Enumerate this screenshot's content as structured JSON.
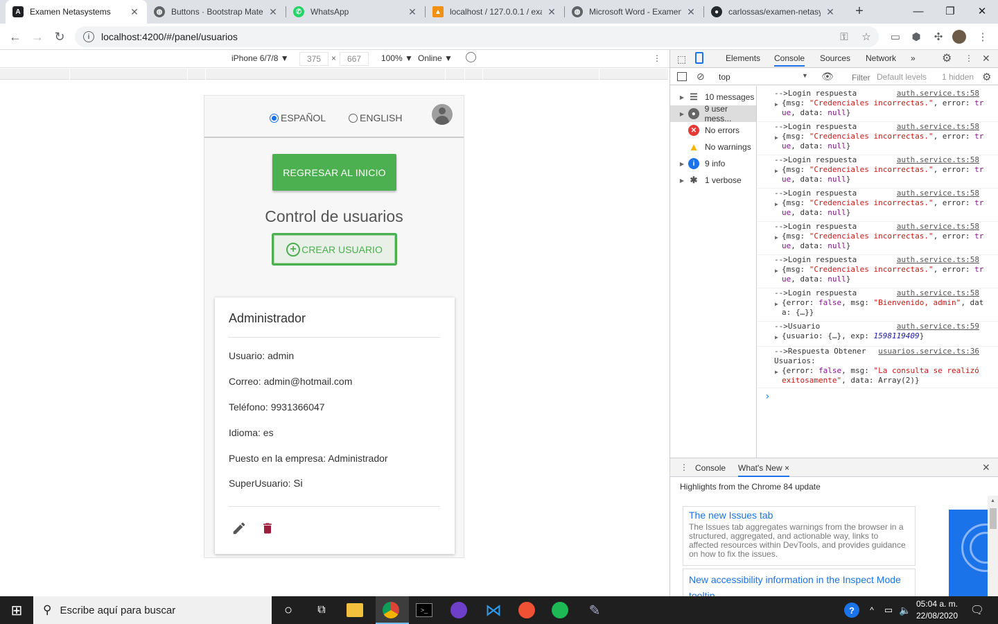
{
  "browser": {
    "tabs": [
      {
        "title": "Examen Netasystems",
        "active": true,
        "icon": "angular-icon"
      },
      {
        "title": "Buttons · Bootstrap Mater",
        "icon": "globe-icon"
      },
      {
        "title": "WhatsApp",
        "icon": "whatsapp-icon"
      },
      {
        "title": "localhost / 127.0.0.1 / exa",
        "icon": "phpmyadmin-icon"
      },
      {
        "title": "Microsoft Word - Examen",
        "icon": "globe-icon"
      },
      {
        "title": "carlossas/examen-netasys",
        "icon": "github-icon"
      }
    ],
    "new_tab": "+",
    "url": "localhost:4200/#/panel/usuarios"
  },
  "device_toolbar": {
    "device": "iPhone 6/7/8 ▼",
    "width": "375",
    "height": "667",
    "x": "×",
    "zoom": "100% ▼",
    "network": "Online ▼"
  },
  "app": {
    "lang_es": "ESPAÑOL",
    "lang_en": "ENGLISH",
    "back_button": "REGRESAR AL INICIO",
    "title": "Control de usuarios",
    "create_button": "CREAR USUARIO",
    "card": {
      "title": "Administrador",
      "fields": [
        "Usuario: admin",
        "Correo: admin@hotmail.com",
        "Teléfono: 9931366047",
        "Idioma: es",
        "Puesto en la empresa: Administrador"
      ],
      "super_label": "SuperUsuario: ",
      "super_value": "Si"
    }
  },
  "devtools": {
    "tabs": [
      "Elements",
      "Console",
      "Sources",
      "Network",
      "»"
    ],
    "context": "top",
    "filter": "Filter",
    "levels": "Default levels",
    "hidden": "1 hidden",
    "sidebar": [
      "10 messages",
      "9 user mess...",
      "No errors",
      "No warnings",
      "9 info",
      "1 verbose"
    ],
    "log_label_login": "-->Login respuesta",
    "log_src_auth58": "auth.service.ts:58",
    "log_err_l1_a": "{msg: ",
    "log_err_l1_b": "\"Credenciales incorrectas.\"",
    "log_err_l1_c": ", error: ",
    "log_err_l1_d": "tr",
    "log_err_l2_a": "ue",
    "log_err_l2_b": ", data: ",
    "log_err_l2_c": "null",
    "log_err_l2_d": "}",
    "log_ok_l1_a": "{error: ",
    "log_ok_l1_b": "false",
    "log_ok_l1_c": ", msg: ",
    "log_ok_l1_d": "\"Bienvenido, admin\"",
    "log_ok_l1_e": ", dat",
    "log_ok_l2": "a: {…}}",
    "log_user_label": "-->Usuario",
    "log_src_auth59": "auth.service.ts:59",
    "log_user_l1_a": "{usuario: {…}, exp: ",
    "log_user_l1_b": "1598119409",
    "log_user_l1_c": "}",
    "log_obt_label": "-->Respuesta Obtener",
    "log_src_usr36": "usuarios.service.ts:36",
    "log_obt_label2": "Usuarios:",
    "log_obt_l1_a": "{error: ",
    "log_obt_l1_b": "false",
    "log_obt_l1_c": ", msg: ",
    "log_obt_l1_d": "\"La consulta se realizó",
    "log_obt_l2_a": "exitosamente\"",
    "log_obt_l2_b": ", data: Array(2)}",
    "prompt": "›",
    "drawer_tabs": [
      "Console",
      "What's New ×"
    ],
    "drawer_heading": "Highlights from the Chrome 84 update",
    "whats_new": [
      {
        "title": "The new Issues tab",
        "body": "The Issues tab aggregates warnings from the browser in a structured, aggregated, and actionable way, links to affected resources within DevTools, and provides guidance on how to fix the issues."
      },
      {
        "title": "New accessibility information in the Inspect Mode tooltip",
        "body": ""
      }
    ]
  },
  "taskbar": {
    "search_placeholder": "Escribe aquí para buscar",
    "time": "05:04 a. m.",
    "date": "22/08/2020"
  },
  "colors": {
    "green": "#4caf50",
    "trash": "#a01c3c",
    "link": "#1a73e8"
  }
}
